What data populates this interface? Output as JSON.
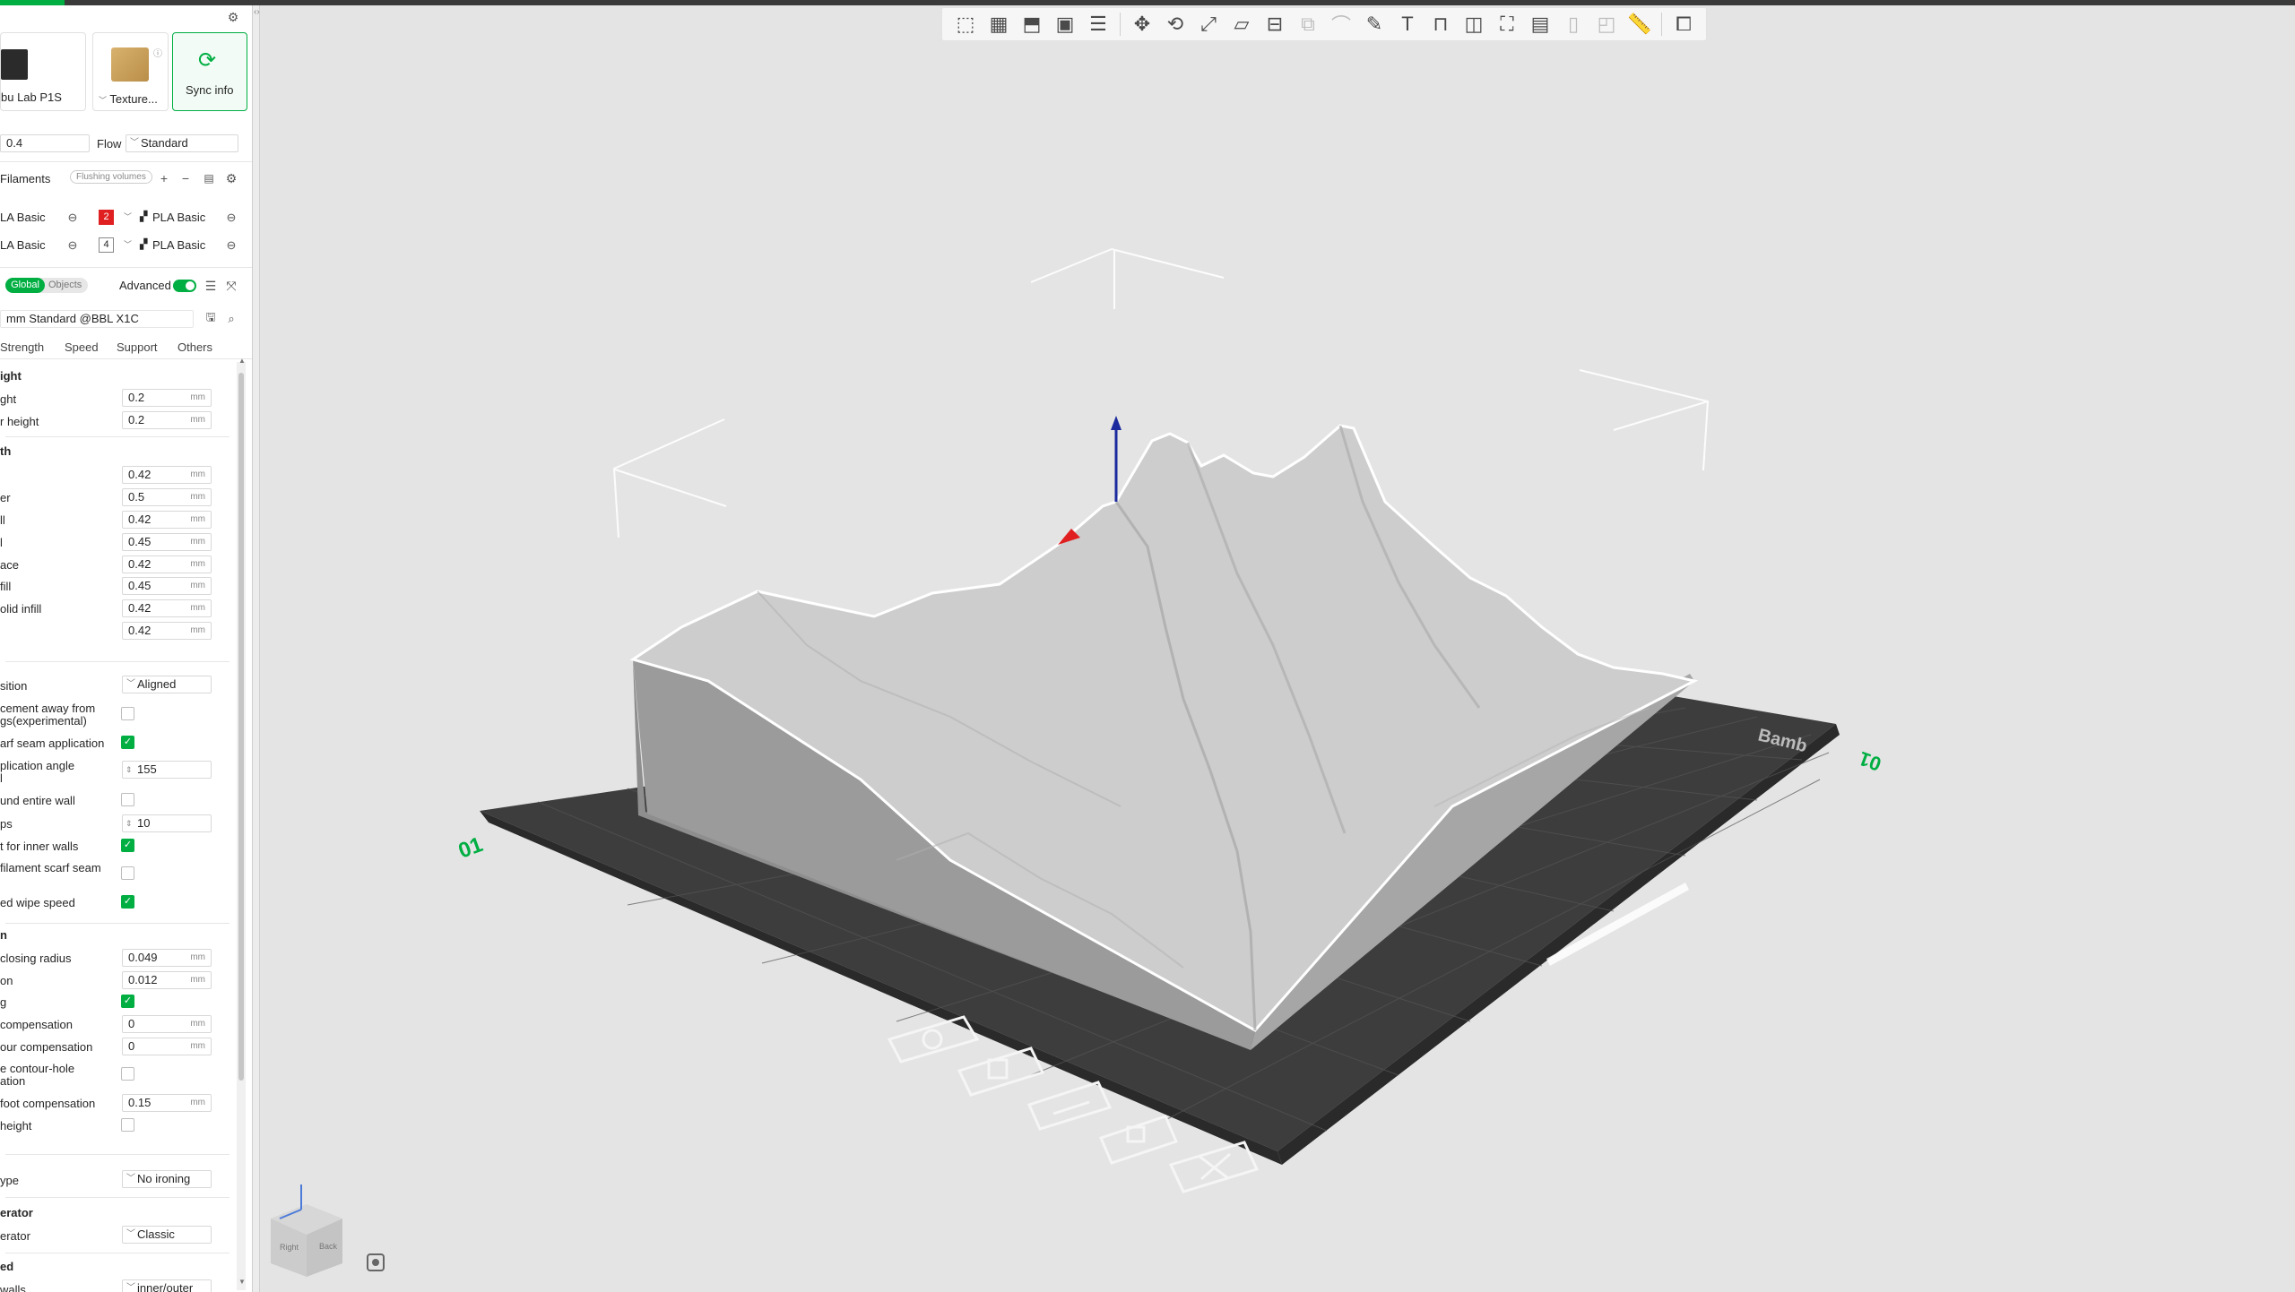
{
  "printer": {
    "name": "bu Lab P1S",
    "plate": "Texture...",
    "sync": "Sync info"
  },
  "nozzle": {
    "value": "0.4",
    "flow_label": "Flow",
    "flow_value": "Standard"
  },
  "filaments": {
    "title": "Filaments",
    "flushing": "Flushing volumes",
    "rows": [
      {
        "left": "LA Basic",
        "index": "2",
        "right": "PLA Basic",
        "color": "#e02020"
      },
      {
        "left": "LA Basic",
        "index": "4",
        "right": "PLA Basic",
        "color": "#ffffff"
      }
    ]
  },
  "settings_mode": {
    "global": "Global",
    "objects": "Objects",
    "advanced": "Advanced"
  },
  "process": {
    "preset": "mm Standard @BBL X1C",
    "tabs": [
      "Strength",
      "Speed",
      "Support",
      "Others"
    ]
  },
  "layer_height": {
    "title": "ight",
    "rows": [
      {
        "label": "ght",
        "value": "0.2",
        "unit": "mm"
      },
      {
        "label": "r height",
        "value": "0.2",
        "unit": "mm"
      }
    ]
  },
  "line_width": {
    "title": "th",
    "rows": [
      {
        "label": "",
        "value": "0.42",
        "unit": "mm"
      },
      {
        "label": "er",
        "value": "0.5",
        "unit": "mm"
      },
      {
        "label": "ll",
        "value": "0.42",
        "unit": "mm"
      },
      {
        "label": "l",
        "value": "0.45",
        "unit": "mm"
      },
      {
        "label": "ace",
        "value": "0.42",
        "unit": "mm"
      },
      {
        "label": "fill",
        "value": "0.45",
        "unit": "mm"
      },
      {
        "label": "olid infill",
        "value": "0.42",
        "unit": "mm"
      },
      {
        "label": "",
        "value": "0.42",
        "unit": "mm"
      }
    ]
  },
  "seam": {
    "position_label": "sition",
    "position_value": "Aligned",
    "placement_label_1": "cement away from",
    "placement_label_2": "gs(experimental)",
    "scarf_app_label": "arf seam application",
    "angle_label_1": "plication angle",
    "angle_label_2": "l",
    "angle_value": "155",
    "entire_wall_label": "und entire wall",
    "steps_label": "ps",
    "steps_value": "10",
    "inner_walls_label": "t for inner walls",
    "filament_scarf_label": "filament scarf seam",
    "wipe_speed_label": "ed wipe speed"
  },
  "precision": {
    "title": "n",
    "closing_label": "closing radius",
    "closing_value": "0.049",
    "resolution_label": "on",
    "resolution_value": "0.012",
    "g_label": "g",
    "comp_label": "compensation",
    "comp_value": "0",
    "contour_label": "our compensation",
    "contour_value": "0",
    "hole_label_1": "e contour-hole",
    "hole_label_2": "ation",
    "foot_label": "foot compensation",
    "foot_value": "0.15",
    "height_label": "height",
    "unit": "mm"
  },
  "ironing": {
    "type_label": "ype",
    "type_value": "No ironing"
  },
  "generator": {
    "title": "erator",
    "label": "erator",
    "value": "Classic"
  },
  "walls": {
    "title": "ed",
    "label": "walls",
    "value": "inner/outer"
  },
  "bed": {
    "plate_label": "01",
    "logo_text": "Bamb"
  },
  "view_cube": {
    "left": "Right",
    "right": "Back"
  },
  "toolbar_icons": [
    "add-cube-icon",
    "grid-icon",
    "orient-icon",
    "arrange-icon",
    "layers-icon",
    "move-icon",
    "rotate-icon",
    "scale-icon",
    "lay-on-face-icon",
    "cut-icon",
    "mesh-boolean-icon",
    "support-paint-icon",
    "seam-paint-icon",
    "text-icon",
    "emboss-icon",
    "measure-cube-icon",
    "bounding-box-icon",
    "assembly-icon",
    "variable-layer-icon",
    "clip-icon",
    "ruler-icon",
    "explode-icon"
  ]
}
